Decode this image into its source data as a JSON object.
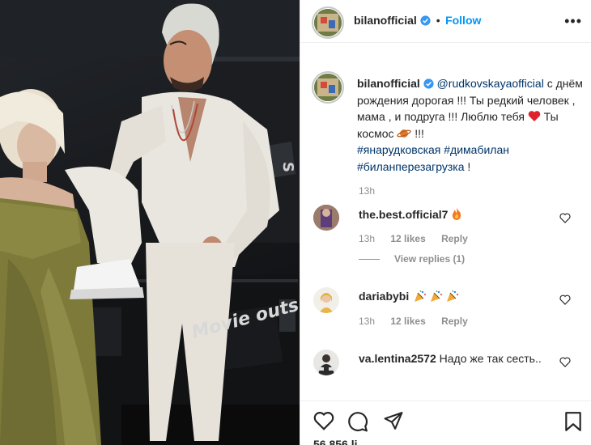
{
  "header": {
    "username": "bilanofficial",
    "separator": "•",
    "follow_label": "Follow",
    "more_icon": "more-horizontal-icon"
  },
  "caption": {
    "username": "bilanofficial",
    "mention": "@rudkovskayaofficial",
    "text1": " с днём рождения дорогая !!! Ты редкий человек , мама , и подруга !!! Люблю тебя ",
    "text2": " Ты космос ",
    "text3": " !!!",
    "tag1": "#янарудковская",
    "tag2": "#димабилан",
    "tag3": "#биланперезагрузка",
    "tail": " !",
    "time": "13h"
  },
  "comments": [
    {
      "username": "the.best.official7",
      "emoji": "fire-emoji",
      "time": "13h",
      "likes": "12 likes",
      "reply": "Reply",
      "view_replies": "View replies (1)"
    },
    {
      "username": "dariabybi",
      "emoji": "party-popper-emoji",
      "time": "13h",
      "likes": "12 likes",
      "reply": "Reply"
    },
    {
      "username": "va.lentina2572",
      "text": " Надо же так сесть..",
      "time": "",
      "likes": "",
      "reply": ""
    }
  ],
  "actions": {
    "like_icon": "heart-icon",
    "comment_icon": "comment-icon",
    "share_icon": "share-icon",
    "save_icon": "bookmark-icon"
  },
  "likes_partial": "56 856 li",
  "colors": {
    "accent": "#0095f6",
    "hashtag": "#003569",
    "muted": "#8e8e8e",
    "text": "#262626"
  }
}
